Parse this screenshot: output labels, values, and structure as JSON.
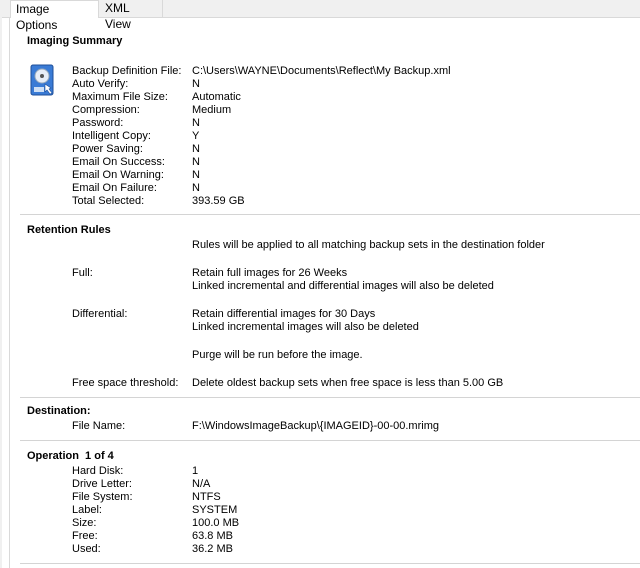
{
  "tabs": [
    {
      "label": "Image Options",
      "active": true
    },
    {
      "label": "XML View",
      "active": false
    }
  ],
  "imaging_summary": {
    "title": "Imaging Summary",
    "icon": "hard-disk-backup-icon",
    "rows": [
      {
        "label": "Backup Definition File:",
        "value": "C:\\Users\\WAYNE\\Documents\\Reflect\\My Backup.xml"
      },
      {
        "label": "Auto Verify:",
        "value": "N"
      },
      {
        "label": "Maximum File Size:",
        "value": "Automatic"
      },
      {
        "label": "Compression:",
        "value": "Medium"
      },
      {
        "label": "Password:",
        "value": "N"
      },
      {
        "label": "Intelligent Copy:",
        "value": "Y"
      },
      {
        "label": "Power Saving:",
        "value": "N"
      },
      {
        "label": "Email On Success:",
        "value": "N"
      },
      {
        "label": "Email On Warning:",
        "value": "N"
      },
      {
        "label": "Email On Failure:",
        "value": "N"
      },
      {
        "label": "Total Selected:",
        "value": "393.59 GB"
      }
    ]
  },
  "retention_rules": {
    "title": "Retention Rules",
    "intro": "Rules will be applied to all matching backup sets in the destination folder",
    "full_label": "Full:",
    "full_line1": "Retain full images for 26 Weeks",
    "full_line2": "Linked incremental and differential images will also be deleted",
    "differential_label": "Differential:",
    "differential_line1": "Retain differential images for 30 Days",
    "differential_line2": "Linked incremental images will also be deleted",
    "purge": "Purge will be run before the image.",
    "free_space_label": "Free space threshold:",
    "free_space_value": "Delete oldest backup sets when free space is less than 5.00 GB"
  },
  "destination": {
    "title": "Destination:",
    "file_name_label": "File Name:",
    "file_name_value": "F:\\WindowsImageBackup\\{IMAGEID}-00-00.mrimg"
  },
  "operation": {
    "title": "Operation  1 of 4",
    "rows": [
      {
        "label": "Hard Disk:",
        "value": "1"
      },
      {
        "label": "Drive Letter:",
        "value": "N/A"
      },
      {
        "label": "File System:",
        "value": "NTFS"
      },
      {
        "label": "Label:",
        "value": "SYSTEM"
      },
      {
        "label": "Size:",
        "value": "100.0 MB"
      },
      {
        "label": "Free:",
        "value": "63.8 MB"
      },
      {
        "label": "Used:",
        "value": "36.2 MB"
      }
    ]
  }
}
